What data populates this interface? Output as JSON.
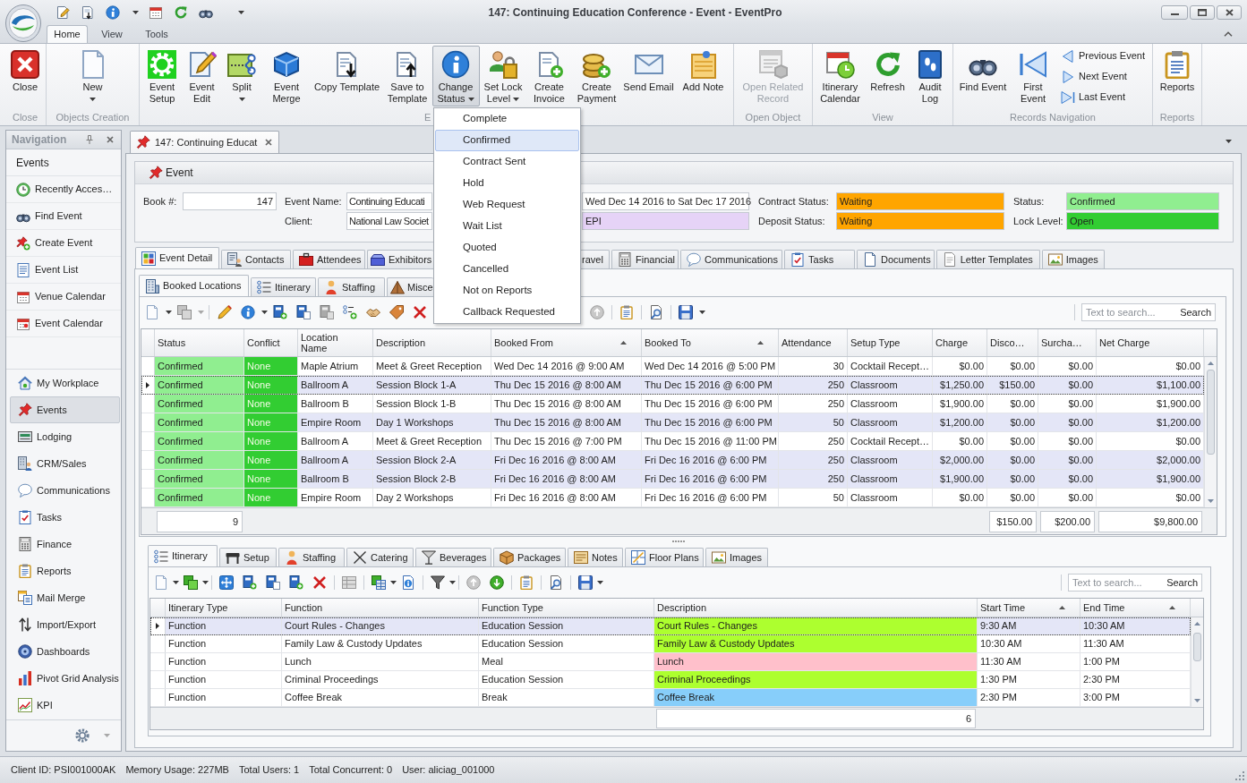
{
  "window": {
    "title": "147: Continuing Education Conference - Event - EventPro"
  },
  "ribbon": {
    "tabs": [
      {
        "label": "Home",
        "selected": true
      },
      {
        "label": "View",
        "selected": false
      },
      {
        "label": "Tools",
        "selected": false
      }
    ],
    "groups": [
      {
        "label": "Close",
        "buttons": [
          {
            "label": "Close",
            "dropdown": false,
            "pressed": false,
            "disabled": false
          }
        ]
      },
      {
        "label": "Objects Creation",
        "buttons": [
          {
            "label": "New",
            "dropdown": true,
            "pressed": false,
            "disabled": false
          }
        ]
      },
      {
        "label": "E",
        "buttons": [
          {
            "label": "Event\nSetup",
            "dropdown": false,
            "pressed": false,
            "disabled": false
          },
          {
            "label": "Event\nEdit",
            "dropdown": false,
            "pressed": false,
            "disabled": false
          },
          {
            "label": "Split",
            "dropdown": true,
            "pressed": false,
            "disabled": false
          },
          {
            "label": "Event\nMerge",
            "dropdown": false,
            "pressed": false,
            "disabled": false
          },
          {
            "label": "Copy Template",
            "dropdown": false,
            "pressed": false,
            "disabled": false
          },
          {
            "label": "Save to\nTemplate",
            "dropdown": false,
            "pressed": false,
            "disabled": false
          },
          {
            "label": "Change\nStatus",
            "dropdown": true,
            "pressed": true,
            "disabled": false,
            "menu": [
              {
                "label": "Complete",
                "selected": false
              },
              {
                "label": "Confirmed",
                "selected": true
              },
              {
                "label": "Contract Sent",
                "selected": false
              },
              {
                "label": "Hold",
                "selected": false
              },
              {
                "label": "Web Request",
                "selected": false
              },
              {
                "label": "Wait List",
                "selected": false
              },
              {
                "label": "Quoted",
                "selected": false
              },
              {
                "label": "Cancelled",
                "selected": false
              },
              {
                "label": "Not on Reports",
                "selected": false
              },
              {
                "label": "Callback Requested",
                "selected": false
              }
            ]
          },
          {
            "label": "Set Lock\nLevel",
            "dropdown": true,
            "pressed": false,
            "disabled": false
          },
          {
            "label": "Create\nInvoice",
            "dropdown": false,
            "pressed": false,
            "disabled": false
          },
          {
            "label": "Create\nPayment",
            "dropdown": false,
            "pressed": false,
            "disabled": false
          },
          {
            "label": "Send Email",
            "dropdown": false,
            "pressed": false,
            "disabled": false
          },
          {
            "label": "Add Note",
            "dropdown": false,
            "pressed": false,
            "disabled": false
          }
        ]
      },
      {
        "label": "Open Object",
        "buttons": [
          {
            "label": "Open Related\nRecord",
            "dropdown": false,
            "pressed": false,
            "disabled": true
          }
        ]
      },
      {
        "label": "View",
        "buttons": [
          {
            "label": "Itinerary\nCalendar",
            "dropdown": false,
            "pressed": false,
            "disabled": false
          },
          {
            "label": "Refresh",
            "dropdown": false,
            "pressed": false,
            "disabled": false
          },
          {
            "label": "Audit\nLog",
            "dropdown": false,
            "pressed": false,
            "disabled": false
          }
        ]
      },
      {
        "label": "Records Navigation",
        "buttons": [
          {
            "label": "Find Event",
            "kind": "large",
            "dropdown": false,
            "pressed": false,
            "disabled": false
          },
          {
            "label": "First\nEvent",
            "kind": "large",
            "dropdown": false,
            "pressed": false,
            "disabled": false
          },
          {
            "label": "Previous Event",
            "kind": "small",
            "dropdown": false,
            "pressed": false,
            "disabled": false
          },
          {
            "label": "Next Event",
            "kind": "small",
            "dropdown": false,
            "pressed": false,
            "disabled": false
          },
          {
            "label": "Last Event",
            "kind": "small",
            "dropdown": false,
            "pressed": false,
            "disabled": false
          }
        ]
      },
      {
        "label": "Reports",
        "buttons": [
          {
            "label": "Reports",
            "dropdown": false,
            "pressed": false,
            "disabled": false
          }
        ]
      }
    ]
  },
  "navigation": {
    "title": "Navigation",
    "section": "Events",
    "links": [
      "Recently Acces…",
      "Find Event",
      "Create Event",
      "Event List",
      "Venue Calendar",
      "Event Calendar"
    ],
    "modules": [
      {
        "label": "My Workplace",
        "selected": false
      },
      {
        "label": "Events",
        "selected": true
      },
      {
        "label": "Lodging",
        "selected": false
      },
      {
        "label": "CRM/Sales",
        "selected": false
      },
      {
        "label": "Communications",
        "selected": false
      },
      {
        "label": "Tasks",
        "selected": false
      },
      {
        "label": "Finance",
        "selected": false
      },
      {
        "label": "Reports",
        "selected": false
      },
      {
        "label": "Mail Merge",
        "selected": false
      },
      {
        "label": "Import/Export",
        "selected": false
      },
      {
        "label": "Dashboards",
        "selected": false
      },
      {
        "label": "Pivot Grid Analysis",
        "selected": false
      },
      {
        "label": "KPI",
        "selected": false
      }
    ]
  },
  "document_tab": {
    "label": "147: Continuing Educat"
  },
  "event": {
    "title": "Event",
    "field_columns": [
      [
        {
          "label": "Book #:",
          "value": "147",
          "kind": "number"
        }
      ],
      [
        {
          "label": "Event Name:",
          "value": "Continuing Educati",
          "kind": "text"
        },
        {
          "label": "Client:",
          "value": "National Law Societ",
          "kind": "text"
        }
      ],
      [
        {
          "value": "Wed Dec 14 2016 to Sat Dec 17 2016",
          "kind": "text"
        },
        {
          "value": "EPI",
          "kind": "text",
          "color": "#e6d3f7"
        }
      ],
      [
        {
          "label": "Contract Status:",
          "value": "Waiting",
          "kind": "text",
          "color": "#ffa500"
        },
        {
          "label": "Deposit Status:",
          "value": "Waiting",
          "kind": "text",
          "color": "#ffa500"
        }
      ],
      [
        {
          "label": "Status:",
          "value": "Confirmed",
          "kind": "text",
          "color": "#90ee90"
        },
        {
          "label": "Lock Level:",
          "value": "Open",
          "kind": "text",
          "color": "#32cd32"
        }
      ]
    ]
  },
  "detail_tabs": [
    {
      "label": "Event Detail",
      "selected": true
    },
    {
      "label": "Contacts",
      "selected": false
    },
    {
      "label": "Attendees",
      "selected": false
    },
    {
      "label": "Exhibitors",
      "selected": false
    },
    {
      "label": "ravel",
      "selected": false
    },
    {
      "label": "Financial",
      "selected": false
    },
    {
      "label": "Communications",
      "selected": false
    },
    {
      "label": "Tasks",
      "selected": false
    },
    {
      "label": "Documents",
      "selected": false
    },
    {
      "label": "Letter Templates",
      "selected": false
    },
    {
      "label": "Images",
      "selected": false
    }
  ],
  "booked_locations": {
    "tabs": [
      {
        "label": "Booked Locations",
        "selected": true
      },
      {
        "label": "Itinerary",
        "selected": false
      },
      {
        "label": "Staffing",
        "selected": false
      },
      {
        "label": "Misce",
        "selected": false
      }
    ],
    "search": {
      "placeholder": "Text to search...",
      "button": "Search"
    },
    "columns": [
      {
        "label": "Status",
        "kind": "text",
        "sorted": false,
        "color": "#90ee90",
        "total": "9"
      },
      {
        "label": "Conflict",
        "kind": "text",
        "sorted": false,
        "color": "#32cd32"
      },
      {
        "label": "Location\nName",
        "kind": "text",
        "sorted": false
      },
      {
        "label": "Description",
        "kind": "text",
        "sorted": false
      },
      {
        "label": "Booked From",
        "kind": "text",
        "sorted": true
      },
      {
        "label": "Booked To",
        "kind": "text",
        "sorted": true
      },
      {
        "label": "Attendance",
        "kind": "number",
        "sorted": false
      },
      {
        "label": "Setup Type",
        "kind": "text",
        "sorted": false
      },
      {
        "label": "Charge",
        "kind": "number",
        "sorted": false
      },
      {
        "label": "Disco…",
        "kind": "number",
        "sorted": false,
        "total": "$150.00"
      },
      {
        "label": "Surcha…",
        "kind": "number",
        "sorted": false,
        "total": "$200.00"
      },
      {
        "label": "Net Charge",
        "kind": "number",
        "sorted": false,
        "total": "$9,800.00"
      }
    ],
    "rows": [
      {
        "cells": [
          "Confirmed",
          "None",
          "Maple Atrium",
          "Meet & Greet Reception",
          "Wed Dec 14 2016 @ 9:00 AM",
          "Wed Dec 14 2016 @ 5:00 PM",
          "30",
          "Cocktail Recept…",
          "$0.00",
          "$0.00",
          "$0.00",
          "$0.00"
        ],
        "selected": false,
        "focused": false
      },
      {
        "cells": [
          "Confirmed",
          "None",
          "Ballroom A",
          "Session Block 1-A",
          "Thu Dec 15 2016 @ 8:00 AM",
          "Thu Dec 15 2016 @ 6:00 PM",
          "250",
          "Classroom",
          "$1,250.00",
          "$150.00",
          "$0.00",
          "$1,100.00"
        ],
        "selected": true,
        "focused": true
      },
      {
        "cells": [
          "Confirmed",
          "None",
          "Ballroom B",
          "Session Block 1-B",
          "Thu Dec 15 2016 @ 8:00 AM",
          "Thu Dec 15 2016 @ 6:00 PM",
          "250",
          "Classroom",
          "$1,900.00",
          "$0.00",
          "$0.00",
          "$1,900.00"
        ],
        "selected": false,
        "focused": false
      },
      {
        "cells": [
          "Confirmed",
          "None",
          "Empire Room",
          "Day 1 Workshops",
          "Thu Dec 15 2016 @ 8:00 AM",
          "Thu Dec 15 2016 @ 6:00 PM",
          "50",
          "Classroom",
          "$1,200.00",
          "$0.00",
          "$0.00",
          "$1,200.00"
        ],
        "selected": true,
        "focused": false
      },
      {
        "cells": [
          "Confirmed",
          "None",
          "Ballroom A",
          "Meet & Greet Reception",
          "Thu Dec 15 2016 @ 7:00 PM",
          "Thu Dec 15 2016 @ 11:00 PM",
          "250",
          "Cocktail Recept…",
          "$0.00",
          "$0.00",
          "$0.00",
          "$0.00"
        ],
        "selected": false,
        "focused": false
      },
      {
        "cells": [
          "Confirmed",
          "None",
          "Ballroom A",
          "Session Block 2-A",
          "Fri Dec 16 2016 @ 8:00 AM",
          "Fri Dec 16 2016 @ 6:00 PM",
          "250",
          "Classroom",
          "$2,000.00",
          "$0.00",
          "$0.00",
          "$2,000.00"
        ],
        "selected": true,
        "focused": false
      },
      {
        "cells": [
          "Confirmed",
          "None",
          "Ballroom B",
          "Session Block 2-B",
          "Fri Dec 16 2016 @ 8:00 AM",
          "Fri Dec 16 2016 @ 6:00 PM",
          "250",
          "Classroom",
          "$1,900.00",
          "$0.00",
          "$0.00",
          "$1,900.00"
        ],
        "selected": true,
        "focused": false
      },
      {
        "cells": [
          "Confirmed",
          "None",
          "Empire Room",
          "Day 2 Workshops",
          "Fri Dec 16 2016 @ 8:00 AM",
          "Fri Dec 16 2016 @ 6:00 PM",
          "50",
          "Classroom",
          "$0.00",
          "$0.00",
          "$0.00",
          "$0.00"
        ],
        "selected": false,
        "focused": false
      }
    ]
  },
  "itinerary": {
    "tabs": [
      {
        "label": "Itinerary",
        "selected": true
      },
      {
        "label": "Setup",
        "selected": false
      },
      {
        "label": "Staffing",
        "selected": false
      },
      {
        "label": "Catering",
        "selected": false
      },
      {
        "label": "Beverages",
        "selected": false
      },
      {
        "label": "Packages",
        "selected": false
      },
      {
        "label": "Notes",
        "selected": false
      },
      {
        "label": "Floor Plans",
        "selected": false
      },
      {
        "label": "Images",
        "selected": false
      }
    ],
    "search": {
      "placeholder": "Text to search...",
      "button": "Search"
    },
    "columns": [
      {
        "label": "Itinerary Type",
        "kind": "text",
        "sorted": false
      },
      {
        "label": "Function",
        "kind": "text",
        "sorted": false
      },
      {
        "label": "Function Type",
        "kind": "text",
        "sorted": false
      },
      {
        "label": "Description",
        "kind": "colored",
        "sorted": false,
        "total": "6"
      },
      {
        "label": "Start Time",
        "kind": "text",
        "sorted": true
      },
      {
        "label": "End Time",
        "kind": "text",
        "sorted": true
      }
    ],
    "rows": [
      {
        "cells": [
          "Function",
          "Court Rules - Changes",
          "Education Session",
          "Court Rules - Changes",
          "9:30 AM",
          "10:30 AM"
        ],
        "color": "#adff2f",
        "selected": true,
        "focused": true
      },
      {
        "cells": [
          "Function",
          "Family Law & Custody Updates",
          "Education Session",
          "Family Law & Custody Updates",
          "10:30 AM",
          "11:30 AM"
        ],
        "color": "#adff2f",
        "selected": false,
        "focused": false
      },
      {
        "cells": [
          "Function",
          "Lunch",
          "Meal",
          "Lunch",
          "11:30 AM",
          "1:00 PM"
        ],
        "color": "#ffc0cb",
        "selected": false,
        "focused": false
      },
      {
        "cells": [
          "Function",
          "Criminal Proceedings",
          "Education Session",
          "Criminal Proceedings",
          "1:30 PM",
          "2:30 PM"
        ],
        "color": "#adff2f",
        "selected": false,
        "focused": false
      },
      {
        "cells": [
          "Function",
          "Coffee Break",
          "Break",
          "Coffee Break",
          "2:30 PM",
          "3:00 PM"
        ],
        "color": "#87cefa",
        "selected": false,
        "focused": false
      }
    ]
  },
  "status_bar": {
    "items": [
      "Client ID: PSI001000AK",
      "Memory Usage: 227MB",
      "Total Users: 1",
      "Total Concurrent: 0",
      "User: aliciag_001000"
    ]
  }
}
